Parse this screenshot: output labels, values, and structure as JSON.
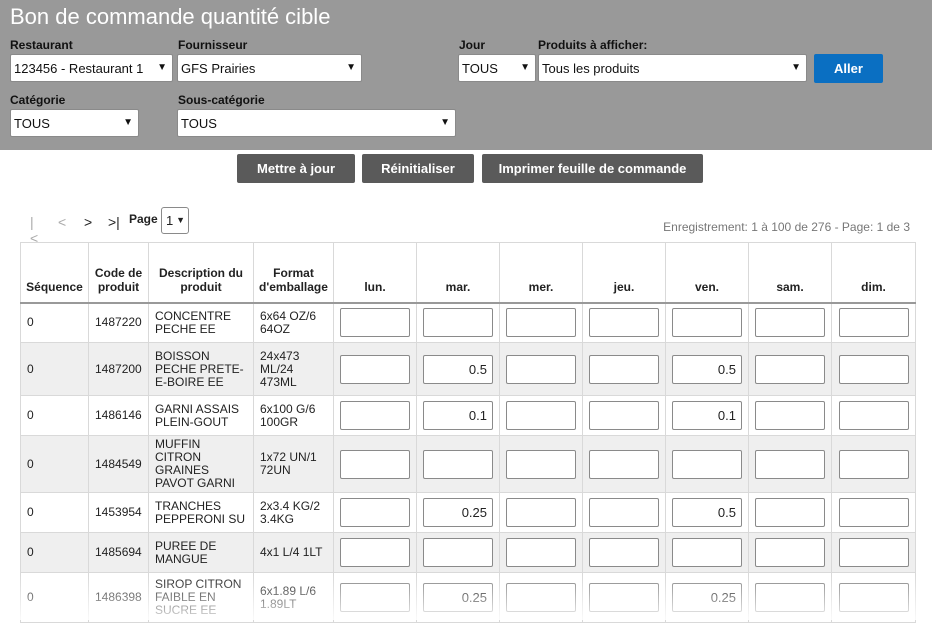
{
  "title": "Bon de commande quantité cible",
  "filters": {
    "restaurant_label": "Restaurant",
    "restaurant_value": "123456 - Restaurant 1",
    "supplier_label": "Fournisseur",
    "supplier_value": "GFS Prairies",
    "day_label": "Jour",
    "day_value": "TOUS",
    "products_label": "Produits à afficher:",
    "products_value": "Tous les produits",
    "go_label": "Aller",
    "category_label": "Catégorie",
    "category_value": "TOUS",
    "subcategory_label": "Sous-catégorie",
    "subcategory_value": "TOUS"
  },
  "actions": {
    "update": "Mettre à jour",
    "reset": "Réinitialiser",
    "print": "Imprimer feuille de commande"
  },
  "pager": {
    "first": "|<",
    "prev": "<",
    "next": ">",
    "last": ">|",
    "page_label": "Page",
    "page_value": "1",
    "record_info": "Enregistrement: 1 à 100 de 276 - Page: 1 de 3"
  },
  "table": {
    "headers": {
      "sequence": "Séquence",
      "code": "Code de produit",
      "description": "Description du produit",
      "format": "Format d'emballage",
      "mon": "lun.",
      "tue": "mar.",
      "wed": "mer.",
      "thu": "jeu.",
      "fri": "ven.",
      "sat": "sam.",
      "sun": "dim."
    },
    "rows": [
      {
        "seq": "0",
        "code": "1487220",
        "desc": "CONCENTRE PECHE EE",
        "format": "6x64 OZ/6 64OZ",
        "mon": "",
        "tue": "",
        "wed": "",
        "thu": "",
        "fri": "",
        "sat": "",
        "sun": ""
      },
      {
        "seq": "0",
        "code": "1487200",
        "desc": "BOISSON PECHE PRETE-E-BOIRE EE",
        "format": "24x473 ML/24 473ML",
        "mon": "",
        "tue": "0.5",
        "wed": "",
        "thu": "",
        "fri": "0.5",
        "sat": "",
        "sun": ""
      },
      {
        "seq": "0",
        "code": "1486146",
        "desc": "GARNI ASSAIS PLEIN-GOUT",
        "format": "6x100 G/6 100GR",
        "mon": "",
        "tue": "0.1",
        "wed": "",
        "thu": "",
        "fri": "0.1",
        "sat": "",
        "sun": ""
      },
      {
        "seq": "0",
        "code": "1484549",
        "desc": "MUFFIN CITRON GRAINES PAVOT GARNI",
        "format": "1x72 UN/1 72UN",
        "mon": "",
        "tue": "",
        "wed": "",
        "thu": "",
        "fri": "",
        "sat": "",
        "sun": ""
      },
      {
        "seq": "0",
        "code": "1453954",
        "desc": "TRANCHES PEPPERONI SU",
        "format": "2x3.4 KG/2 3.4KG",
        "mon": "",
        "tue": "0.25",
        "wed": "",
        "thu": "",
        "fri": "0.5",
        "sat": "",
        "sun": ""
      },
      {
        "seq": "0",
        "code": "1485694",
        "desc": "PUREE DE MANGUE",
        "format": "4x1 L/4 1LT",
        "mon": "",
        "tue": "",
        "wed": "",
        "thu": "",
        "fri": "",
        "sat": "",
        "sun": ""
      },
      {
        "seq": "0",
        "code": "1486398",
        "desc": "SIROP CITRON FAIBLE EN SUCRE EE",
        "format": "6x1.89 L/6 1.89LT",
        "mon": "",
        "tue": "0.25",
        "wed": "",
        "thu": "",
        "fri": "0.25",
        "sat": "",
        "sun": ""
      }
    ]
  }
}
